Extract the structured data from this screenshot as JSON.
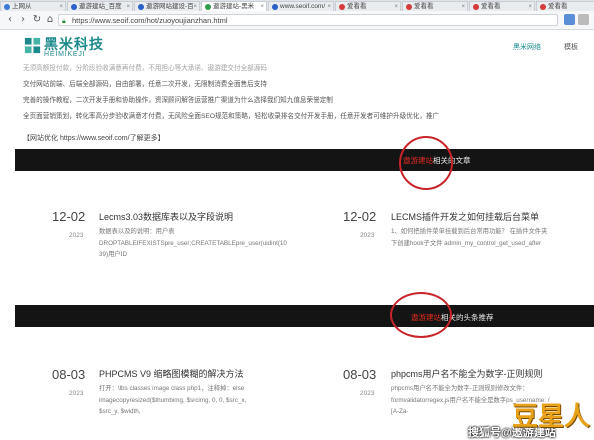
{
  "browser": {
    "tabs": [
      {
        "label": "上网从",
        "color": "#3a7bd5",
        "active": false
      },
      {
        "label": "遨游建站_百度",
        "color": "#2b5fc9",
        "active": false
      },
      {
        "label": "遨游网站建设-百",
        "color": "#2b5fc9",
        "active": false
      },
      {
        "label": "遨游建站-黑米",
        "color": "#2e9b4a",
        "active": true
      },
      {
        "label": "www.seoif.com/",
        "color": "#2b5fc9",
        "active": false
      },
      {
        "label": "爱看看",
        "color": "#d43a3a",
        "active": false
      },
      {
        "label": "爱看看",
        "color": "#d43a3a",
        "active": false
      },
      {
        "label": "爱看看",
        "color": "#d43a3a",
        "active": false
      },
      {
        "label": "爱看看",
        "color": "#d43a3a",
        "active": false
      },
      {
        "label": "爱看看",
        "color": "#d43a3a",
        "active": false
      }
    ],
    "url": "https://www.seoif.com/hot/zuoyoujianzhan.html"
  },
  "site": {
    "logo_cn": "黑米科技",
    "logo_en": "HEIMIKEJI",
    "nav": [
      {
        "label": "黑米网络",
        "active": true
      },
      {
        "label": "模板",
        "active": false
      }
    ]
  },
  "article": {
    "paragraphs": [
      "无须高额投付款，分阶段验收满意再付费，不用担心等大承诺、遨游建交付全部源码",
      "交付网站前端、后端全部源码，自由部署，任意二次开发，无限制消费全面售后支持",
      "完善的操作教程，二次开发手册和协助操作，资深顾问解答运营推广渠道为什么选择我们知九值息荣誉定制",
      "全页面营销策划，转化率高分步验收满意才付费，无风险全面SEO规范和策略，轻松收录排名交付开发手册，任意开发者可维护升级优化，推广"
    ],
    "link_line": "【网站优化 https://www.seoif.com/了解更多】"
  },
  "section1": {
    "title_highlight": "遨游建站",
    "title_rest": "相关的文章"
  },
  "section2": {
    "title_highlight": "遨游建站",
    "title_rest": "相关的头条推荐"
  },
  "articles_row1": [
    {
      "date": "12-02",
      "year": "2023",
      "title": "Lecms3.03数据库表以及字段说明",
      "body": [
        "数据表以及的说明：用户表",
        "DROPTABLEIFEXISTSpre_user;CREATETABLEpre_user(uidint(10",
        "39)用户ID"
      ]
    },
    {
      "date": "12-02",
      "year": "2023",
      "title": "LECMS插件开发之如何挂载后台菜单",
      "body": [
        "1、如何把插件菜单挂载到后台常用功能？ 在插件文件夹",
        "下创建hook子文件 admin_my_control_get_used_after"
      ]
    }
  ],
  "articles_row2": [
    {
      "date": "08-03",
      "year": "2023",
      "title": "PHPCMS V9 缩略图模糊的解决方法",
      "body": [
        "打开：\\lbs classes image class php1，注释掉：else",
        "imagecopyresized($thumbimg, $srcimg, 0, 0, $src_x,",
        "$src_y, $width,"
      ]
    },
    {
      "date": "08-03",
      "year": "2023",
      "title": "phpcms用户名不能全为数字-正则规则",
      "body": [
        "phpcms用户名不能全为数字-正则规则修改文件：",
        "formvalidatorregex.js用户名不能全是数字ps_username: /",
        "[A-Za-"
      ]
    }
  ],
  "watermark": {
    "text": "搜狐号@遨游建站",
    "logo": "豆星人"
  }
}
